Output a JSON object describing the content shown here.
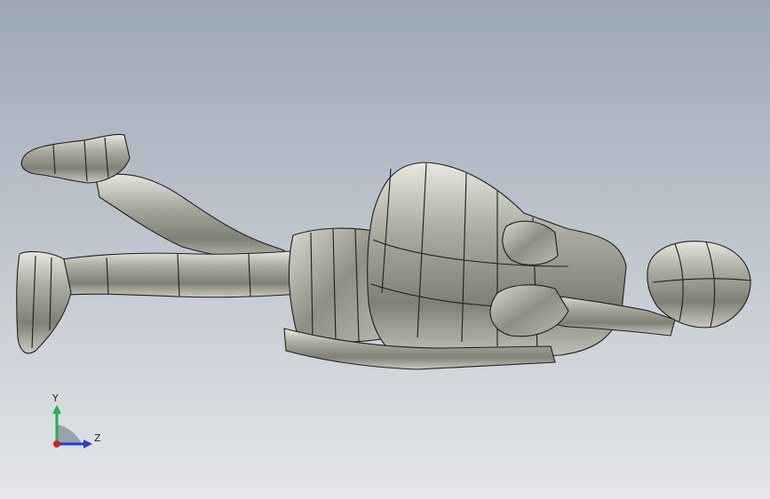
{
  "viewport": {
    "background_top": "#9ca7b6",
    "background_bottom": "#e4e6e9",
    "model_color": "#a9ab9e",
    "edge_color": "#1d1d1d"
  },
  "triad": {
    "y_label": "Y",
    "z_label": "Z",
    "y_color": "#22b14c",
    "z_color": "#1f3fd6",
    "x_color": "#d41e1e"
  }
}
